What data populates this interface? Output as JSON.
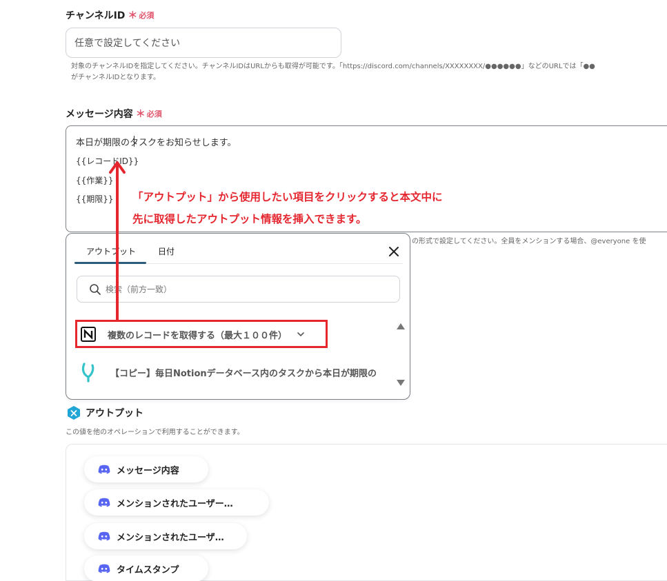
{
  "channel_field": {
    "label": "チャンネルID",
    "required_mark": "＊",
    "required_text": "必須",
    "placeholder": "任意で設定してください",
    "help_line1": "対象のチャンネルIDを指定してください。チャンネルIDはURLからも取得が可能です。「https://discord.com/channels/XXXXXXXX/●●●●●●」などのURLでは「●●",
    "help_line2": "がチャンネルIDとなります。"
  },
  "message_field": {
    "label": "メッセージ内容",
    "required_mark": "＊",
    "required_text": "必須",
    "lines": [
      "本日が期限のタスクをお知らせします。",
      "{{レコードID}}",
      "{{作業}}",
      "{{期限}}"
    ],
    "help_partial": "の形式で設定してください。全員をメンションする場合、@everyone を使"
  },
  "annotation": {
    "line1": "「アウトプット」から使用したい項目をクリックすると本文中に",
    "line2": "先に取得したアウトプット情報を挿入できます。"
  },
  "popover": {
    "tabs": [
      "アウトプット",
      "日付"
    ],
    "active_tab": 0,
    "search_placeholder": "検索（前方一致）",
    "groups": [
      {
        "icon": "notion-icon",
        "label": "複数のレコードを取得する（最大１００件）"
      },
      {
        "icon": "yoom-icon",
        "label": "【コピー】毎日Notionデータベース内のタスクから本日が期限の"
      }
    ]
  },
  "output_section": {
    "title": "アウトプット",
    "description": "この値を他のオペレーションで利用することができます。",
    "chips": [
      "メッセージ内容",
      "メンションされたユーザー…",
      "メンションされたユーザ…",
      "タイムスタンプ"
    ]
  },
  "colors": {
    "accent_red": "#e5262f",
    "required_pink": "#e0556b",
    "tab_underline": "#2d5b7a",
    "discord_purple": "#5865f2",
    "output_badge": "#1fa5d6"
  }
}
